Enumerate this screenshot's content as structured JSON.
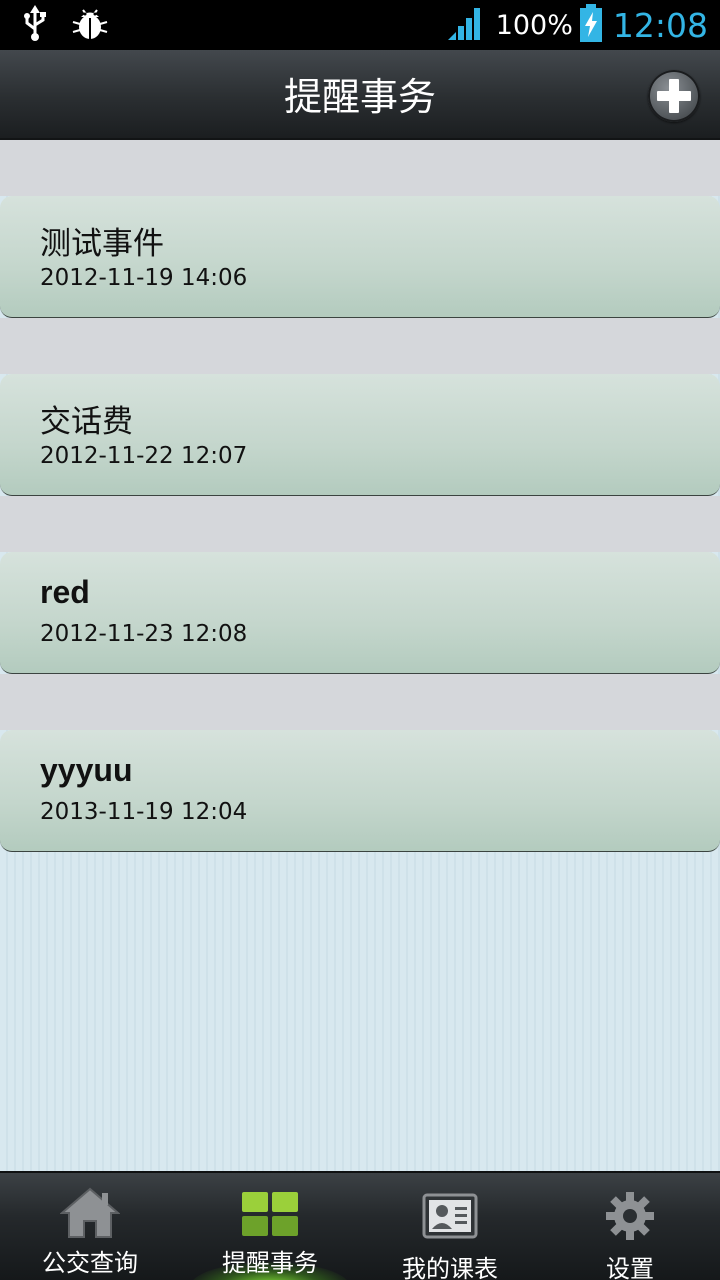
{
  "status_bar": {
    "icons": [
      "usb-icon",
      "debug-bug-icon",
      "signal-icon",
      "battery-charging-icon"
    ],
    "battery_percent": "100%",
    "clock": "12:08",
    "accent_color": "#33b5e5"
  },
  "header": {
    "title": "提醒事务",
    "add_icon": "plus-icon"
  },
  "reminders": [
    {
      "title": "测试事件",
      "time": "2012-11-19 14:06"
    },
    {
      "title": "交话费",
      "time": "2012-11-22 12:07"
    },
    {
      "title": "red",
      "time": "2012-11-23 12:08"
    },
    {
      "title": "yyyuu",
      "time": "2013-11-19 12:04"
    }
  ],
  "tabs": [
    {
      "label": "公交查询",
      "icon": "home-icon",
      "active": false
    },
    {
      "label": "提醒事务",
      "icon": "grid-icon",
      "active": true
    },
    {
      "label": "我的课表",
      "icon": "contact-card-icon",
      "active": false
    },
    {
      "label": "设置",
      "icon": "gear-icon",
      "active": false
    }
  ]
}
